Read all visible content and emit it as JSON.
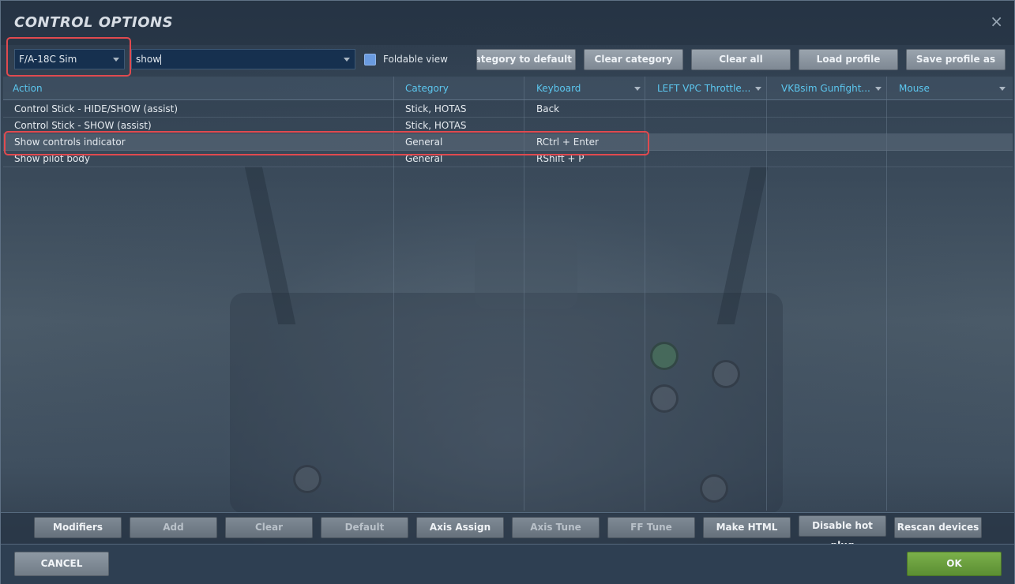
{
  "window": {
    "title": "CONTROL OPTIONS",
    "close_label": "×"
  },
  "toolbar": {
    "aircraft_select": "F/A-18C Sim",
    "search_value": "show",
    "foldable_label": "Foldable view",
    "foldable_checked": true,
    "buttons": {
      "reset_category": "Reset category to default",
      "clear_category": "Clear category",
      "clear_all": "Clear all",
      "load_profile": "Load profile",
      "save_profile": "Save profile as"
    }
  },
  "table": {
    "columns": [
      "Action",
      "Category",
      "Keyboard",
      "LEFT VPC Throttle...",
      "VKBsim Gunfight...",
      "Mouse"
    ],
    "rows": [
      {
        "action": "Control Stick - HIDE/SHOW (assist)",
        "category": "Stick, HOTAS",
        "keyboard": "Back",
        "selected": false
      },
      {
        "action": "Control Stick - SHOW (assist)",
        "category": "Stick, HOTAS",
        "keyboard": "",
        "selected": false
      },
      {
        "action": "Show controls indicator",
        "category": "General",
        "keyboard": "RCtrl + Enter",
        "selected": true
      },
      {
        "action": "Show pilot body",
        "category": "General",
        "keyboard": "RShift + P",
        "selected": false
      }
    ]
  },
  "bottom_buttons": {
    "modifiers": "Modifiers",
    "add": "Add",
    "clear": "Clear",
    "default": "Default",
    "axis_assign": "Axis Assign",
    "axis_tune": "Axis Tune",
    "ff_tune": "FF Tune",
    "make_html": "Make HTML",
    "disable_hot_plug": "Disable hot plug",
    "rescan_devices": "Rescan devices"
  },
  "footer": {
    "cancel": "CANCEL",
    "ok": "OK"
  },
  "colors": {
    "accent_header": "#5cc7ef",
    "ok_green": "#6fa43f",
    "highlight_red": "#e04a4f"
  }
}
